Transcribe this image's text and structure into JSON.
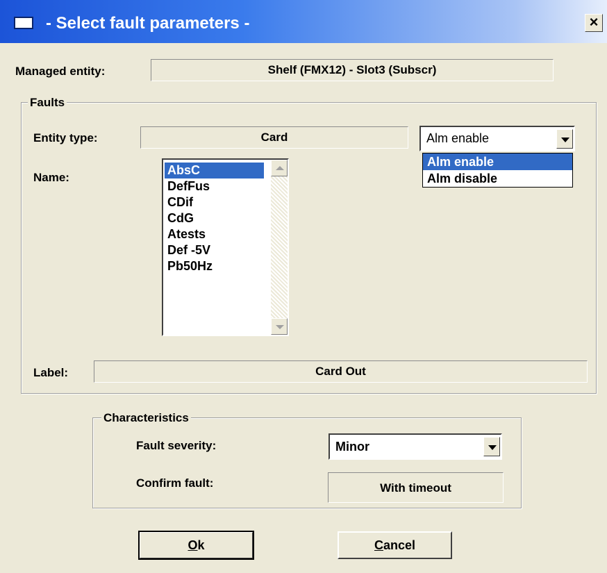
{
  "window": {
    "title": "- Select fault parameters -",
    "close_glyph": "×"
  },
  "managed_entity": {
    "label": "Managed entity:",
    "value": "Shelf (FMX12) - Slot3 (Subscr)"
  },
  "faults": {
    "group_title": "Faults",
    "entity_type_label": "Entity type:",
    "entity_type_value": "Card",
    "alarm_combo": {
      "selected": "Alm enable",
      "options": [
        "Alm enable",
        "Alm disable"
      ],
      "highlighted": "Alm enable"
    },
    "name_label": "Name:",
    "names": [
      "AbsC",
      "DefFus",
      "CDif",
      "CdG",
      "Atests",
      "Def -5V",
      "Pb50Hz"
    ],
    "selected_name": "AbsC",
    "label_label": "Label:",
    "label_value": "Card Out"
  },
  "characteristics": {
    "group_title": "Characteristics",
    "severity_label": "Fault severity:",
    "severity_value": "Minor",
    "confirm_label": "Confirm fault:",
    "confirm_value": "With timeout"
  },
  "buttons": {
    "ok_mnemonic": "O",
    "ok_rest": "k",
    "cancel_mnemonic": "C",
    "cancel_rest": "ancel"
  },
  "colors": {
    "title_gradient_start": "#1c54d8",
    "selection": "#316ac5",
    "dialog_bg": "#ece9d8"
  }
}
